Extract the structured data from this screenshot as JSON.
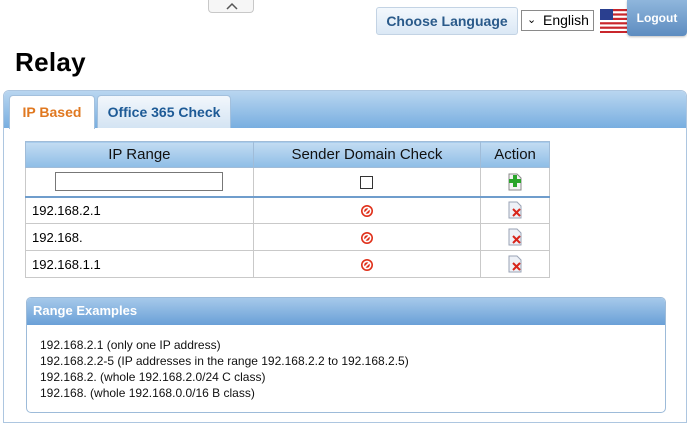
{
  "header": {
    "choose_language_label": "Choose Language",
    "language_selected": "English",
    "logout_label": "Logout"
  },
  "page": {
    "title": "Relay"
  },
  "tabs": [
    {
      "label": "IP Based",
      "active": true
    },
    {
      "label": "Office 365 Check",
      "active": false
    }
  ],
  "table": {
    "columns": [
      "IP Range",
      "Sender Domain Check",
      "Action"
    ],
    "new_entry": {
      "ip_value": "",
      "sender_domain_checked": false
    },
    "rows": [
      {
        "ip": "192.168.2.1",
        "sender_domain_check": "disabled"
      },
      {
        "ip": "192.168.",
        "sender_domain_check": "disabled"
      },
      {
        "ip": "192.168.1.1",
        "sender_domain_check": "disabled"
      }
    ]
  },
  "examples": {
    "title": "Range Examples",
    "lines": [
      "192.168.2.1 (only one IP address)",
      "192.168.2.2-5 (IP addresses in the range 192.168.2.2 to 192.168.2.5)",
      "192.168.2. (whole 192.168.2.0/24 C class)",
      "192.168. (whole 192.168.0.0/16 B class)"
    ]
  },
  "icons": {
    "collapse": "chevron-up-icon",
    "flag": "us-flag-icon",
    "add": "add-document-icon",
    "disabled": "disabled-icon",
    "delete": "delete-document-icon"
  },
  "colors": {
    "active_tab_text": "#e07820",
    "header_blue": "#78aee0",
    "disabled_red": "#e0301a",
    "add_green": "#2aa52a"
  }
}
